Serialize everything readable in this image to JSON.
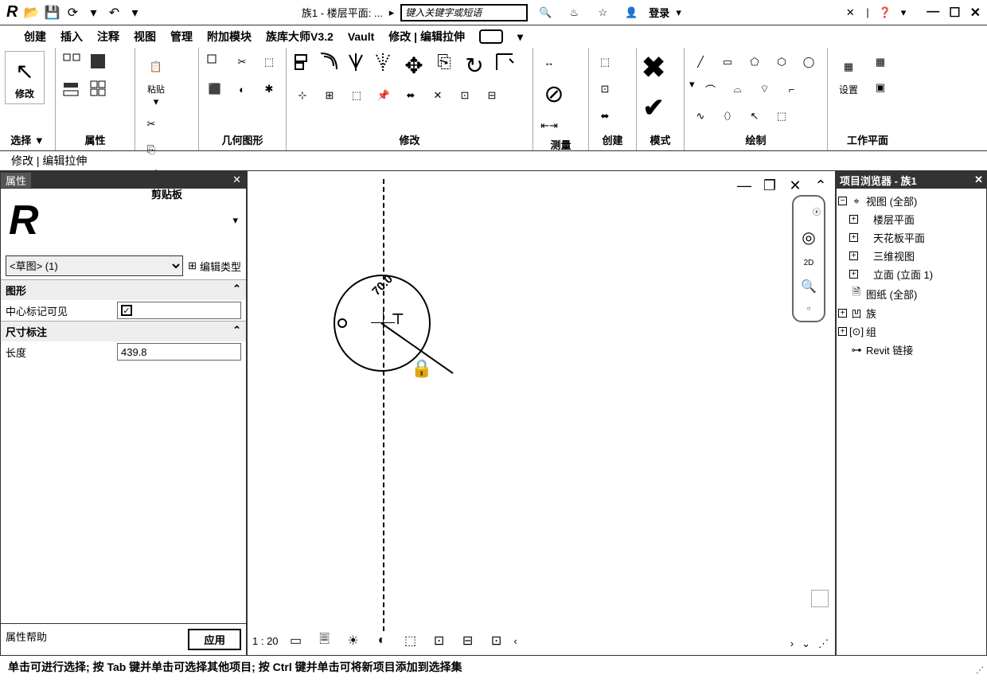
{
  "titlebar": {
    "doc_title": "族1 - 楼层平面: ...",
    "search_placeholder": "键入关键字或短语",
    "login": "登录"
  },
  "menubar": {
    "items": [
      "创建",
      "插入",
      "注释",
      "视图",
      "管理",
      "附加模块",
      "族库大师V3.2",
      "Vault",
      "修改 | 编辑拉伸"
    ]
  },
  "ribbon": {
    "panels": {
      "select": "选择 ▼",
      "select_btn": "修改",
      "props": "属性",
      "clipboard": "剪贴板",
      "clipboard_paste": "粘贴",
      "geometry": "几何图形",
      "modify": "修改",
      "measure": "测量",
      "create": "创建",
      "mode": "模式",
      "draw": "绘制",
      "workplane": "工作平面",
      "workplane_set": "设置"
    }
  },
  "context_tab": "修改 | 编辑拉伸",
  "properties": {
    "title": "属性",
    "type_selector": "<草图>  (1)",
    "edit_type": "编辑类型",
    "group_graphics": "图形",
    "center_mark_visible": "中心标记可见",
    "group_dim": "尺寸标注",
    "length_label": "长度",
    "length_value": "439.8",
    "help": "属性帮助",
    "apply": "应用"
  },
  "canvas": {
    "dim_value": "70.0",
    "scale": "1 : 20"
  },
  "navwheel": {
    "mode": "2D"
  },
  "browser": {
    "title": "项目浏览器 - 族1",
    "nodes": {
      "views_all": "视图 (全部)",
      "floor_plan": "楼层平面",
      "ceiling_plan": "天花板平面",
      "three_d": "三维视图",
      "elevations": "立面 (立面 1)",
      "sheets": "图纸 (全部)",
      "families": "族",
      "groups": "组",
      "links": "Revit 链接"
    }
  },
  "status_text": "单击可进行选择; 按 Tab 键并单击可选择其他项目; 按 Ctrl 键并单击可将新项目添加到选择集"
}
